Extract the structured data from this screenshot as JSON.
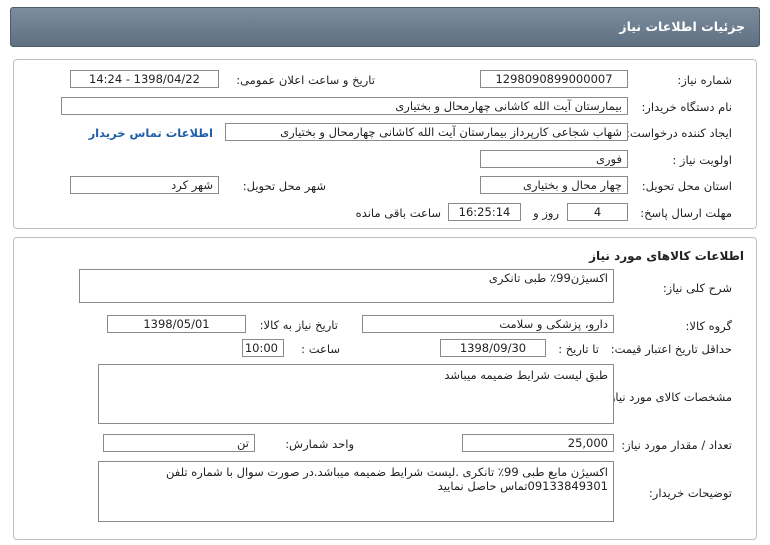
{
  "header": {
    "title": "جزئیات اطلاعات نیاز"
  },
  "info": {
    "need_number_label": "شماره نیاز:",
    "need_number": "1298090899000007",
    "announce_label": "تاریخ و ساعت اعلان عمومی:",
    "announce_value": "1398/04/22 - 14:24",
    "buyer_label": "نام دستگاه خریدار:",
    "buyer_value": "بیمارستان آیت الله کاشانی چهارمحال و بختیاری",
    "creator_label": "ایجاد کننده درخواست:",
    "creator_value": "شهاب شجاعی کارپرداز بیمارستان آیت الله کاشانی چهارمحال و بختیاری",
    "contact_link": "اطلاعات تماس خریدار",
    "priority_label": "اولویت نیاز :",
    "priority_value": "فوری",
    "province_label": "استان محل تحویل:",
    "province_value": "چهار محال و بختیاری",
    "city_label": "شهر محل تحویل:",
    "city_value": "شهر کرد",
    "deadline_label": "مهلت ارسال پاسخ:",
    "days_value": "4",
    "days_label": "روز و",
    "time_value": "16:25:14",
    "remaining_label": "ساعت باقی مانده"
  },
  "goods": {
    "title": "اطلاعات کالاهای مورد نیاز",
    "desc_label": "شرح کلی نیاز:",
    "desc_value": "اکسیژن99٪ طبی تانکری",
    "group_label": "گروه کالا:",
    "group_value": "دارو، پزشکی و سلامت",
    "need_date_label": "تاریخ نیاز به کالا:",
    "need_date_value": "1398/05/01",
    "validity_label": "حداقل تاریخ اعتبار قیمت:",
    "until_date_label": "تا تاریخ :",
    "until_date_value": "1398/09/30",
    "hour_label": "ساعت :",
    "hour_value": "10:00",
    "spec_label": "مشخصات کالای مورد نیاز:",
    "spec_value": "طبق لیست شرایط ضمیمه میباشد",
    "qty_label": "تعداد / مقدار مورد نیاز:",
    "qty_value": "25,000",
    "unit_label": "واحد شمارش:",
    "unit_value": "تن",
    "buyer_notes_label": "توضیحات خریدار:",
    "buyer_notes_value": "اکسیژن مایع طبی 99٪ تانکری .لیست شرایط ضمیمه میباشد.در صورت سوال با شماره تلفن 09133849301تماس حاصل نمایید"
  }
}
